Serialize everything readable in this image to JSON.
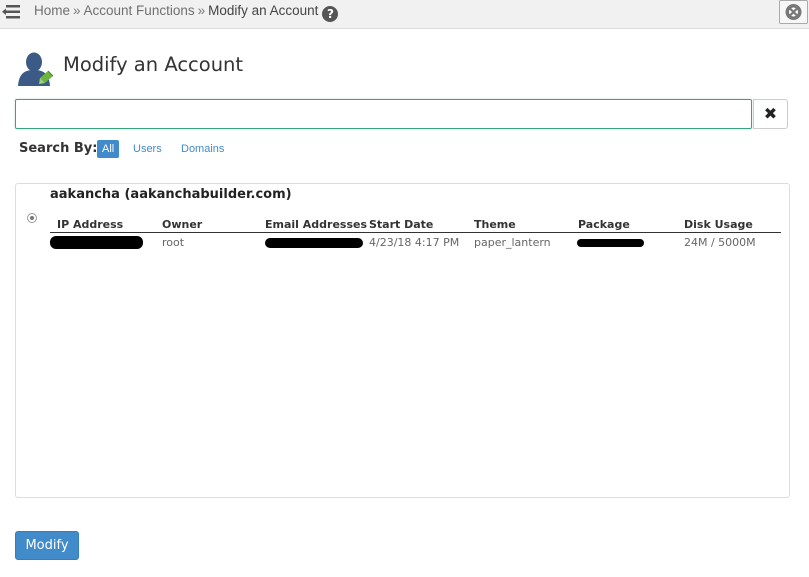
{
  "breadcrumb": {
    "home": "Home",
    "separator": "»",
    "section": "Account Functions",
    "current": "Modify an Account",
    "help": "?"
  },
  "page": {
    "title": "Modify an Account"
  },
  "search": {
    "value": "",
    "clear_label": "✖",
    "search_by_label": "Search By:",
    "filters": [
      "All",
      "Users",
      "Domains"
    ],
    "active_filter": "All"
  },
  "account": {
    "name": "aakancha (aakanchabuilder.com)",
    "columns": [
      "IP Address",
      "Owner",
      "Email Addresses",
      "Start Date",
      "Theme",
      "Package",
      "Disk Usage"
    ],
    "owner": "root",
    "start_date": "4/23/18 4:17 PM",
    "theme": "paper_lantern",
    "disk_usage": "24M / 5000M"
  },
  "actions": {
    "modify_label": "Modify"
  },
  "colors": {
    "accent": "#428bca",
    "focus_border": "#36a57d"
  }
}
